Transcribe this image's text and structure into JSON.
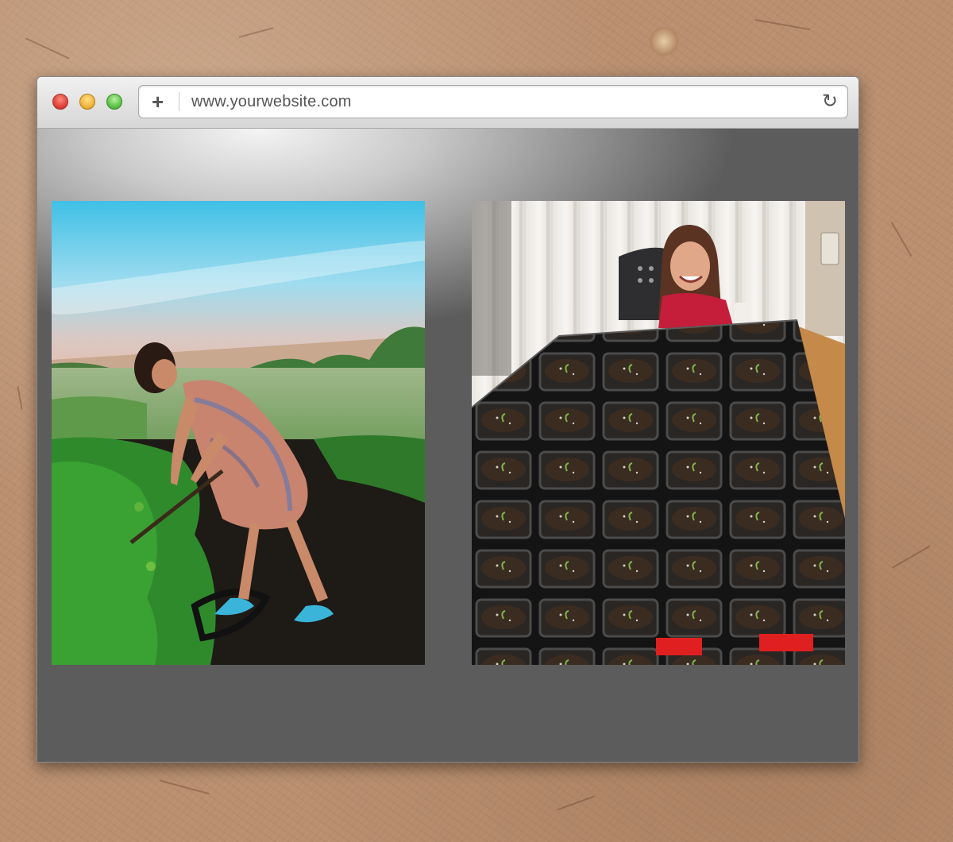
{
  "browser": {
    "url": "www.yourwebsite.com",
    "new_tab_icon": "plus-icon",
    "reload_icon": "reload-icon",
    "traffic_lights": [
      "close",
      "minimize",
      "zoom"
    ]
  },
  "photos": [
    {
      "icon": "photo-woman-gardening"
    },
    {
      "icon": "photo-girl-seedlings"
    }
  ],
  "colors": {
    "paper": "#b98f70",
    "window_chrome": "#d8d8d8"
  }
}
